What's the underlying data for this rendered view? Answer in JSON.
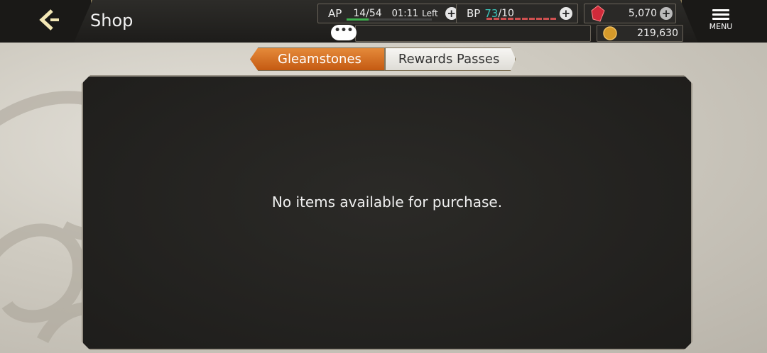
{
  "header": {
    "title": "Shop"
  },
  "ap": {
    "label": "AP",
    "value": "14/54",
    "timer": "01:11",
    "timer_suffix": "Left",
    "fill": 0.26
  },
  "bp": {
    "label": "BP",
    "current": "73",
    "max": "/10"
  },
  "currency": {
    "gems": "5,070",
    "gold": "219,630"
  },
  "menu": {
    "label": "MENU"
  },
  "chat": {
    "glyph": "•••"
  },
  "tabs": [
    {
      "label": "Gleamstones",
      "active": true
    },
    {
      "label": "Rewards Passes",
      "active": false
    }
  ],
  "panel": {
    "message": "No items available for purchase."
  },
  "colors": {
    "accent": "#d8732a",
    "ap_bar": "#3fb14f",
    "bp_text": "#3cc2b8",
    "bp_bar": "#d05050"
  },
  "icons": {
    "back": "back-arrow-icon",
    "gem": "red-gem-icon",
    "gold": "gold-coin-icon",
    "menu": "hamburger-icon",
    "chat": "chat-bubble-icon",
    "plus": "plus-icon"
  }
}
